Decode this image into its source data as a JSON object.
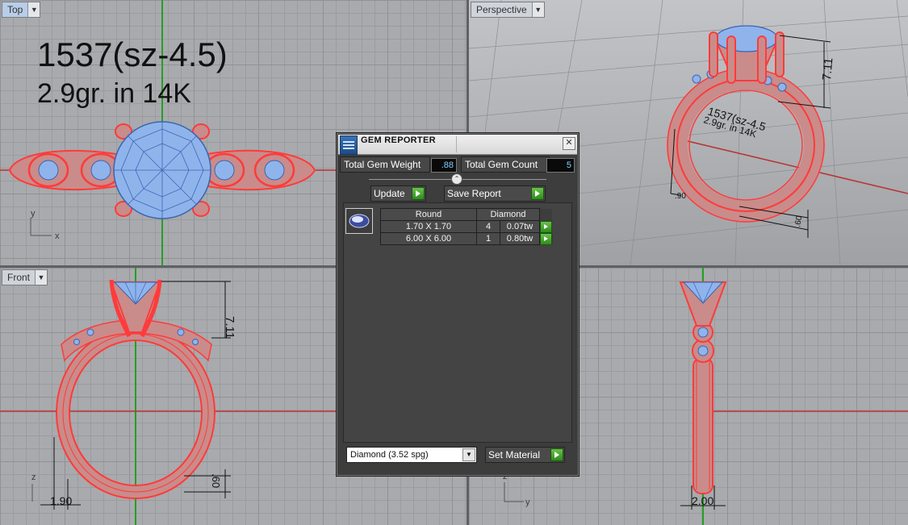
{
  "viewports": {
    "top": {
      "tab_label": "Top",
      "annotation_line1": "1537(sz-4.5)",
      "annotation_line2": "2.9gr.  in 14K",
      "axis_y": "y",
      "axis_x": "x"
    },
    "perspective": {
      "tab_label": "Perspective",
      "dim_height": "7.11",
      "dim_shank": ".90",
      "dim_band": ".60",
      "text_line1": "1537(sz-4.5",
      "text_line2": "2.9gr.  in 14K"
    },
    "front": {
      "tab_label": "Front",
      "dim_height": "7.11",
      "dim_bottom": ".60",
      "dim_width": "1.90",
      "axis_z": "z"
    },
    "right": {
      "dim_width": "2.00",
      "axis_z": "z",
      "axis_y": "y"
    }
  },
  "gem_reporter": {
    "title": "GEM REPORTER",
    "close_glyph": "✕",
    "total_weight_label": "Total Gem Weight",
    "total_weight_value": ".88",
    "total_count_label": "Total Gem Count",
    "total_count_value": "5",
    "slider_glyph": "⌃",
    "update_label": "Update",
    "save_report_label": "Save Report",
    "table_headers": [
      "Round",
      "Diamond"
    ],
    "rows": [
      {
        "size": "1.70 X 1.70",
        "count": "4",
        "weight": "0.07tw"
      },
      {
        "size": "6.00 X 6.00",
        "count": "1",
        "weight": "0.80tw"
      }
    ],
    "material_select": "Diamond     (3.52 spg)",
    "select_arrow": "▼",
    "set_material_label": "Set Material"
  },
  "colors": {
    "ring_fill": "#c98c8a",
    "ring_outline": "#ff3b3b",
    "gem_fill": "#8fb4ec",
    "axis_green": "#23a023",
    "axis_red": "#b83333"
  },
  "icons": {
    "viewport_dropdown": "▼",
    "gem": "gem-icon",
    "go_arrow": "play-arrow-icon"
  }
}
